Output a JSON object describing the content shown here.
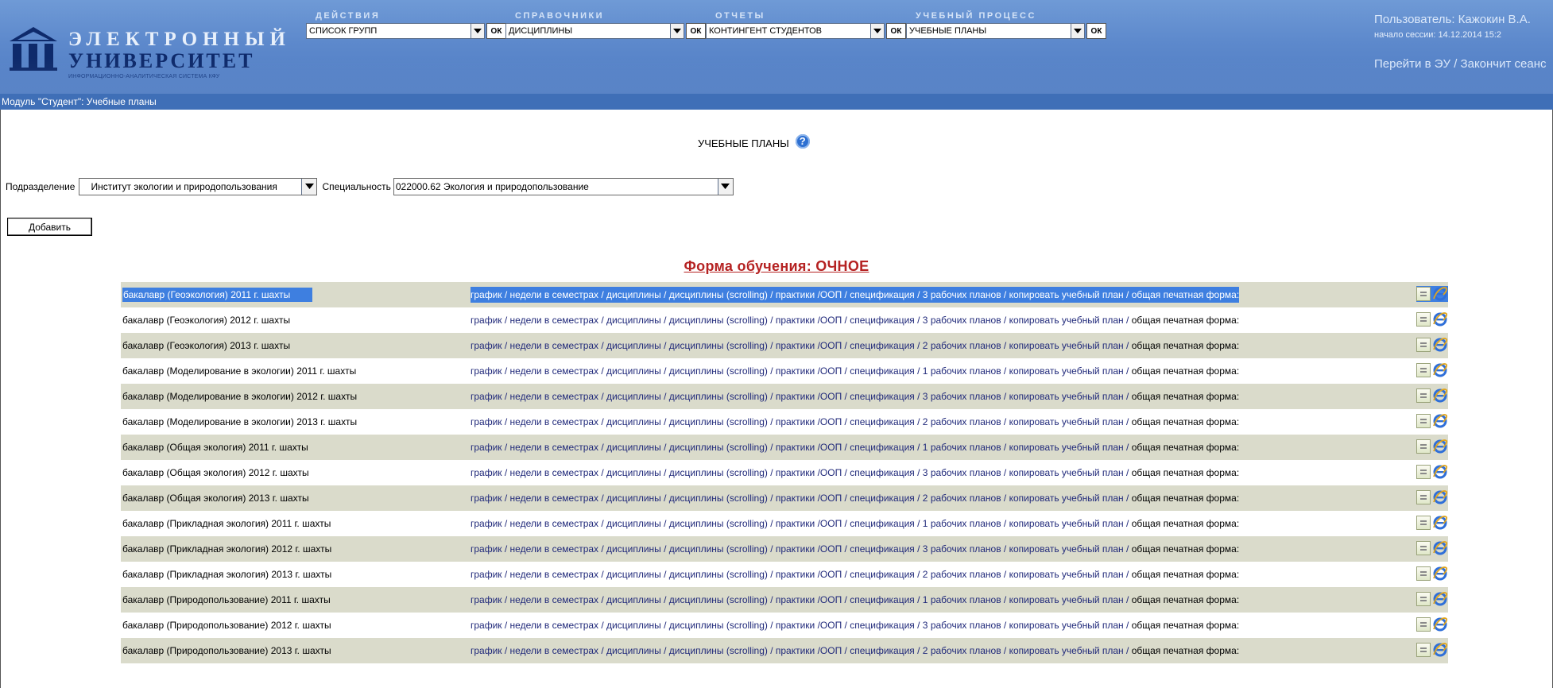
{
  "header": {
    "logo": {
      "line1": "ЭЛЕКТРОННЫЙ",
      "line2": "УНИВЕРСИТЕТ",
      "line3": "ИНФОРМАЦИОННО-АНАЛИТИЧЕСКАЯ СИСТЕМА КФУ"
    },
    "menus": [
      {
        "title": "ДЕЙСТВИЯ",
        "selected": "СПИСОК ГРУПП",
        "ok": "ОК"
      },
      {
        "title": "СПРАВОЧНИКИ",
        "selected": "ДИСЦИПЛИНЫ",
        "ok": "ОК"
      },
      {
        "title": "ОТЧЕТЫ",
        "selected": "КОНТИНГЕНТ СТУДЕНТОВ",
        "ok": "ОК"
      },
      {
        "title": "УЧЕБНЫЙ ПРОЦЕСС",
        "selected": "УЧЕБНЫЕ ПЛАНЫ",
        "ok": "ОК"
      }
    ],
    "user": {
      "name": "Пользователь: Кажокин В.А.",
      "session": "начало сессии: 14.12.2014 15:2",
      "links": "Перейти в ЭУ / Закончит сеанс"
    }
  },
  "module_bar": "Модуль \"Студент\": Учебные планы",
  "page": {
    "title": "УЧЕБНЫЕ ПЛАНЫ",
    "help_glyph": "?",
    "filters": {
      "division_label": "Подразделение",
      "division_value": "Институт экологии и природопользования",
      "specialty_label": "Специальность",
      "specialty_value": "022000.62 Экология и природопользование"
    },
    "add_button": "Добавить",
    "form_title": "Форма обучения: ОЧНОЕ"
  },
  "plans": [
    {
      "name": "бакалавр (Геоэкология) 2011 г. шахты",
      "links": "график / недели в семестрах / дисциплины / дисциплины (scrolling) / практики /ООП / спецификация / 3 рабочих планов / копировать учебный план / ",
      "tail": "общая печатная форма:"
    },
    {
      "name": "бакалавр (Геоэкология) 2012 г. шахты",
      "links": "график / недели в семестрах / дисциплины / дисциплины (scrolling) / практики /ООП / спецификация / 3 рабочих планов / копировать учебный план / ",
      "tail": "общая печатная форма:"
    },
    {
      "name": "бакалавр (Геоэкология) 2013 г. шахты",
      "links": "график / недели в семестрах / дисциплины / дисциплины (scrolling) / практики /ООП / спецификация / 2 рабочих планов / копировать учебный план / ",
      "tail": "общая печатная форма:"
    },
    {
      "name": "бакалавр (Моделирование в экологии) 2011 г. шахты",
      "links": "график / недели в семестрах / дисциплины / дисциплины (scrolling) / практики /ООП / спецификация / 1 рабочих планов / копировать учебный план / ",
      "tail": "общая печатная форма:"
    },
    {
      "name": "бакалавр (Моделирование в экологии) 2012 г. шахты",
      "links": "график / недели в семестрах / дисциплины / дисциплины (scrolling) / практики /ООП / спецификация / 3 рабочих планов / копировать учебный план / ",
      "tail": "общая печатная форма:"
    },
    {
      "name": "бакалавр (Моделирование в экологии) 2013 г. шахты",
      "links": "график / недели в семестрах / дисциплины / дисциплины (scrolling) / практики /ООП / спецификация / 2 рабочих планов / копировать учебный план / ",
      "tail": "общая печатная форма:"
    },
    {
      "name": "бакалавр (Общая экология) 2011 г. шахты",
      "links": "график / недели в семестрах / дисциплины / дисциплины (scrolling) / практики /ООП / спецификация / 1 рабочих планов / копировать учебный план / ",
      "tail": "общая печатная форма:"
    },
    {
      "name": "бакалавр (Общая экология) 2012 г. шахты",
      "links": "график / недели в семестрах / дисциплины / дисциплины (scrolling) / практики /ООП / спецификация / 3 рабочих планов / копировать учебный план / ",
      "tail": "общая печатная форма:"
    },
    {
      "name": "бакалавр (Общая экология) 2013 г. шахты",
      "links": "график / недели в семестрах / дисциплины / дисциплины (scrolling) / практики /ООП / спецификация / 2 рабочих планов / копировать учебный план / ",
      "tail": "общая печатная форма:"
    },
    {
      "name": "бакалавр (Прикладная экология) 2011 г. шахты",
      "links": "график / недели в семестрах / дисциплины / дисциплины (scrolling) / практики /ООП / спецификация / 1 рабочих планов / копировать учебный план / ",
      "tail": "общая печатная форма:"
    },
    {
      "name": "бакалавр (Прикладная экология) 2012 г. шахты",
      "links": "график / недели в семестрах / дисциплины / дисциплины (scrolling) / практики /ООП / спецификация / 3 рабочих планов / копировать учебный план / ",
      "tail": "общая печатная форма:"
    },
    {
      "name": "бакалавр (Прикладная экология) 2013 г. шахты",
      "links": "график / недели в семестрах / дисциплины / дисциплины (scrolling) / практики /ООП / спецификация / 2 рабочих планов / копировать учебный план / ",
      "tail": "общая печатная форма:"
    },
    {
      "name": "бакалавр (Природопользование) 2011 г. шахты",
      "links": "график / недели в семестрах / дисциплины / дисциплины (scrolling) / практики /ООП / спецификация / 1 рабочих планов / копировать учебный план / ",
      "tail": "общая печатная форма:"
    },
    {
      "name": "бакалавр (Природопользование) 2012 г. шахты",
      "links": "график / недели в семестрах / дисциплины / дисциплины (scrolling) / практики /ООП / спецификация / 3 рабочих планов / копировать учебный план / ",
      "tail": "общая печатная форма:"
    },
    {
      "name": "бакалавр (Природопользование) 2013 г. шахты",
      "links": "график / недели в семестрах / дисциплины / дисциплины (scrolling) / практики /ООП / спецификация / 2 рабочих планов / копировать учебный план / ",
      "tail": "общая печатная форма:"
    }
  ],
  "colors": {
    "header_blue": "#5d89cc",
    "module_bar": "#3f6fb7",
    "row_shade": "#dadbcb",
    "link_color": "#20297a",
    "form_title": "#b52222",
    "selection": "#3e7fe0"
  },
  "icons": {
    "print_doc": "document-icon",
    "browser": "ie-icon",
    "dropdown": "chevron-down-icon",
    "help": "help-icon"
  }
}
